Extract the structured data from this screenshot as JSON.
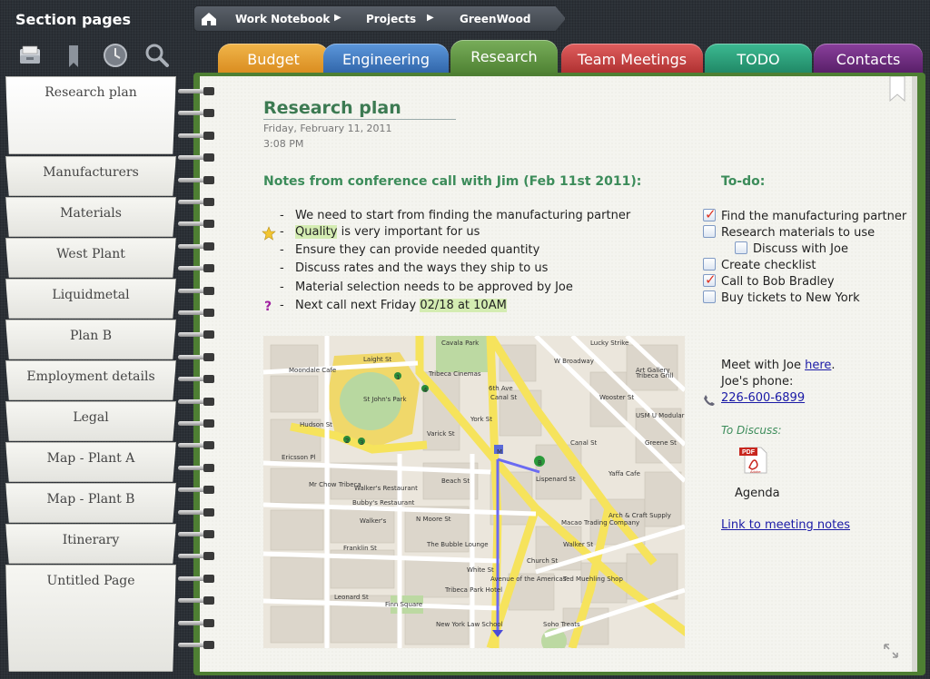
{
  "sidebar": {
    "title": "Section pages",
    "icons": [
      "inbox-icon",
      "bookmark-icon",
      "clock-icon",
      "search-icon"
    ],
    "pages": [
      {
        "label": "Research plan",
        "selected": true
      },
      {
        "label": "Manufacturers"
      },
      {
        "label": "Materials"
      },
      {
        "label": "West Plant"
      },
      {
        "label": "Liquidmetal"
      },
      {
        "label": "Plan B"
      },
      {
        "label": "Employment details"
      },
      {
        "label": "Legal"
      },
      {
        "label": "Map - Plant A"
      },
      {
        "label": "Map - Plant B"
      },
      {
        "label": "Itinerary"
      },
      {
        "label": "Untitled Page"
      }
    ]
  },
  "breadcrumb": {
    "home_icon": "home-icon",
    "items": [
      "Work Notebook",
      "Projects",
      "GreenWood"
    ]
  },
  "tabs": [
    {
      "label": "Budget",
      "color": "#e09a2a"
    },
    {
      "label": "Engineering",
      "color": "#3f7cc6"
    },
    {
      "label": "Research",
      "color": "#5a9440",
      "active": true
    },
    {
      "label": "Team Meetings",
      "color": "#c84242"
    },
    {
      "label": "TODO",
      "color": "#2a9a78"
    },
    {
      "label": "Contacts",
      "color": "#6a2a7a"
    }
  ],
  "note": {
    "title": "Research plan",
    "date": "Friday, February 11, 2011",
    "time": "3:08 PM",
    "heading": "Notes from conference call with Jim (Feb 11st 2011):",
    "lines": [
      {
        "dash": "-",
        "text": "We need to start from finding the manufacturing partner"
      },
      {
        "dash": "-",
        "hl": "Quality",
        "text": " is very important for us"
      },
      {
        "dash": "-",
        "text": "Ensure they can provide needed quantity"
      },
      {
        "dash": "-",
        "text": "Discuss rates and the ways they ship to us"
      },
      {
        "dash": "-",
        "text": "Material selection needs to be approved by Joe"
      },
      {
        "dash": "-",
        "text": "Next call next Friday ",
        "hl2": "02/18 at 10AM"
      }
    ],
    "question_mark": "?"
  },
  "todo": {
    "heading": "To-do:",
    "items": [
      {
        "label": "Find the manufacturing partner",
        "checked": true
      },
      {
        "label": "Research materials to use",
        "checked": false
      },
      {
        "label": "Discuss with Joe",
        "checked": false,
        "indent": true
      },
      {
        "label": "Create checklist",
        "checked": false
      },
      {
        "label": "Call to Bob Bradley",
        "checked": true
      },
      {
        "label": "Buy tickets to New York",
        "checked": false
      }
    ]
  },
  "info": {
    "meet_prefix": "Meet with Joe ",
    "meet_link": "here",
    "meet_suffix": ".",
    "phone_label": "Joe's phone:",
    "phone": "226-600-6899",
    "discuss": "To Discuss:",
    "attachment": "Agenda",
    "pdf_label": "PDF",
    "pdf_brand": "Adobe",
    "meeting_link": "Link to meeting notes"
  },
  "map": {
    "labels": [
      "Cavala Park",
      "Laight St",
      "St John's Park",
      "Moondale Cafe",
      "Hudson St",
      "Tribeca Cinemas",
      "York St",
      "Varick St",
      "Ericsson Pl",
      "Canal St",
      "6th Ave",
      "Beach St",
      "N Moore St",
      "Walker's",
      "Franklin St",
      "Leonard St",
      "Finn Square",
      "White St",
      "Church St",
      "Avenue of the Americas",
      "Lispenard St",
      "W Broadway",
      "Walker St",
      "Canal St",
      "Tribeca Grill",
      "Bubby's Restaurant",
      "Mr Chow Tribeca",
      "The Bubble Lounge",
      "Tribeca Park Hotel",
      "Macao Trading Company",
      "Ted Muehling Shop",
      "Soho Treats",
      "New York Law School",
      "Lucky Strike",
      "Art Gallery",
      "USM U Modular Furniture",
      "Yaffa Cafe",
      "Wooster St",
      "Greene St",
      "Arch & Craft Supply",
      "Walker's Restaurant"
    ],
    "markers": [
      "1",
      "2",
      "3",
      "4",
      "M",
      "B"
    ]
  },
  "icons": {
    "star": "star-icon",
    "phone": "phone-icon",
    "pdf": "pdf-icon",
    "resize": "resize-icon",
    "bookmark": "page-bookmark-icon"
  }
}
